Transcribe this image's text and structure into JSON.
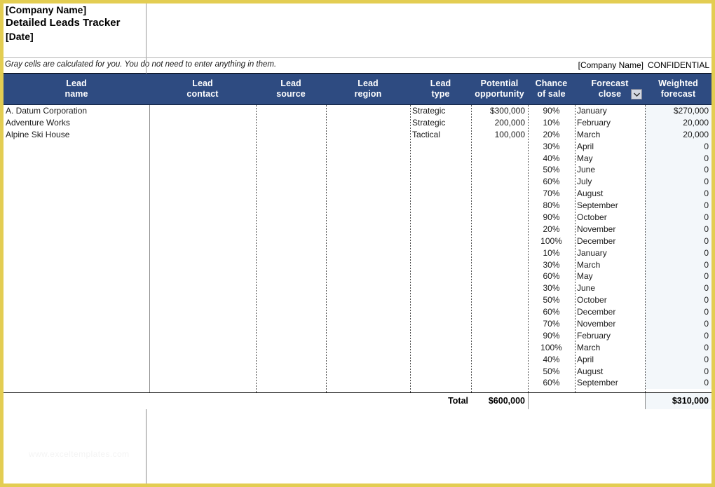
{
  "document": {
    "company_name": "[Company Name]",
    "title": "Detailed Leads Tracker",
    "date": "[Date]",
    "note": "Gray cells are calculated for you. You do not need to enter anything in them.",
    "confidential_company": "[Company Name]",
    "confidential_label": "CONFIDENTIAL",
    "watermark": "www.exceltemplates.com"
  },
  "colors": {
    "header_background": "#2e4b81",
    "header_text": "#ffffff",
    "page_border": "#e3cd52",
    "calculated_cell": "#f3f7fa",
    "grid_line": "#8c8c8c"
  },
  "table": {
    "columns": [
      {
        "line1": "Lead",
        "line2": "name",
        "key": "lead_name",
        "align": "left"
      },
      {
        "line1": "Lead",
        "line2": "contact",
        "key": "lead_contact",
        "align": "left"
      },
      {
        "line1": "Lead",
        "line2": "source",
        "key": "lead_source",
        "align": "left"
      },
      {
        "line1": "Lead",
        "line2": "region",
        "key": "lead_region",
        "align": "left"
      },
      {
        "line1": "Lead",
        "line2": "type",
        "key": "lead_type",
        "align": "left"
      },
      {
        "line1": "Potential",
        "line2": "opportunity",
        "key": "potential_opportunity",
        "align": "right"
      },
      {
        "line1": "Chance",
        "line2": "of sale",
        "key": "chance_of_sale",
        "align": "center"
      },
      {
        "line1": "Forecast",
        "line2": "close",
        "key": "forecast_close",
        "align": "left"
      },
      {
        "line1": "Weighted",
        "line2": "forecast",
        "key": "weighted_forecast",
        "align": "right"
      }
    ],
    "filter_column": "Forecast close",
    "filter_icon": "chevron-down-icon",
    "rows": [
      {
        "lead_name": "A. Datum Corporation",
        "lead_contact": "",
        "lead_source": "",
        "lead_region": "",
        "lead_type": "Strategic",
        "potential_opportunity": "$300,000",
        "chance_of_sale": "90%",
        "forecast_close": "January",
        "weighted_forecast": "$270,000"
      },
      {
        "lead_name": "Adventure Works",
        "lead_contact": "",
        "lead_source": "",
        "lead_region": "",
        "lead_type": "Strategic",
        "potential_opportunity": "200,000",
        "chance_of_sale": "10%",
        "forecast_close": "February",
        "weighted_forecast": "20,000"
      },
      {
        "lead_name": "Alpine Ski House",
        "lead_contact": "",
        "lead_source": "",
        "lead_region": "",
        "lead_type": "Tactical",
        "potential_opportunity": "100,000",
        "chance_of_sale": "20%",
        "forecast_close": "March",
        "weighted_forecast": "20,000"
      },
      {
        "lead_name": "",
        "lead_contact": "",
        "lead_source": "",
        "lead_region": "",
        "lead_type": "",
        "potential_opportunity": "",
        "chance_of_sale": "30%",
        "forecast_close": "April",
        "weighted_forecast": "0"
      },
      {
        "lead_name": "",
        "lead_contact": "",
        "lead_source": "",
        "lead_region": "",
        "lead_type": "",
        "potential_opportunity": "",
        "chance_of_sale": "40%",
        "forecast_close": "May",
        "weighted_forecast": "0"
      },
      {
        "lead_name": "",
        "lead_contact": "",
        "lead_source": "",
        "lead_region": "",
        "lead_type": "",
        "potential_opportunity": "",
        "chance_of_sale": "50%",
        "forecast_close": "June",
        "weighted_forecast": "0"
      },
      {
        "lead_name": "",
        "lead_contact": "",
        "lead_source": "",
        "lead_region": "",
        "lead_type": "",
        "potential_opportunity": "",
        "chance_of_sale": "60%",
        "forecast_close": "July",
        "weighted_forecast": "0"
      },
      {
        "lead_name": "",
        "lead_contact": "",
        "lead_source": "",
        "lead_region": "",
        "lead_type": "",
        "potential_opportunity": "",
        "chance_of_sale": "70%",
        "forecast_close": "August",
        "weighted_forecast": "0"
      },
      {
        "lead_name": "",
        "lead_contact": "",
        "lead_source": "",
        "lead_region": "",
        "lead_type": "",
        "potential_opportunity": "",
        "chance_of_sale": "80%",
        "forecast_close": "September",
        "weighted_forecast": "0"
      },
      {
        "lead_name": "",
        "lead_contact": "",
        "lead_source": "",
        "lead_region": "",
        "lead_type": "",
        "potential_opportunity": "",
        "chance_of_sale": "90%",
        "forecast_close": "October",
        "weighted_forecast": "0"
      },
      {
        "lead_name": "",
        "lead_contact": "",
        "lead_source": "",
        "lead_region": "",
        "lead_type": "",
        "potential_opportunity": "",
        "chance_of_sale": "20%",
        "forecast_close": "November",
        "weighted_forecast": "0"
      },
      {
        "lead_name": "",
        "lead_contact": "",
        "lead_source": "",
        "lead_region": "",
        "lead_type": "",
        "potential_opportunity": "",
        "chance_of_sale": "100%",
        "forecast_close": "December",
        "weighted_forecast": "0"
      },
      {
        "lead_name": "",
        "lead_contact": "",
        "lead_source": "",
        "lead_region": "",
        "lead_type": "",
        "potential_opportunity": "",
        "chance_of_sale": "10%",
        "forecast_close": "January",
        "weighted_forecast": "0"
      },
      {
        "lead_name": "",
        "lead_contact": "",
        "lead_source": "",
        "lead_region": "",
        "lead_type": "",
        "potential_opportunity": "",
        "chance_of_sale": "30%",
        "forecast_close": "March",
        "weighted_forecast": "0"
      },
      {
        "lead_name": "",
        "lead_contact": "",
        "lead_source": "",
        "lead_region": "",
        "lead_type": "",
        "potential_opportunity": "",
        "chance_of_sale": "60%",
        "forecast_close": "May",
        "weighted_forecast": "0"
      },
      {
        "lead_name": "",
        "lead_contact": "",
        "lead_source": "",
        "lead_region": "",
        "lead_type": "",
        "potential_opportunity": "",
        "chance_of_sale": "30%",
        "forecast_close": "June",
        "weighted_forecast": "0"
      },
      {
        "lead_name": "",
        "lead_contact": "",
        "lead_source": "",
        "lead_region": "",
        "lead_type": "",
        "potential_opportunity": "",
        "chance_of_sale": "50%",
        "forecast_close": "October",
        "weighted_forecast": "0"
      },
      {
        "lead_name": "",
        "lead_contact": "",
        "lead_source": "",
        "lead_region": "",
        "lead_type": "",
        "potential_opportunity": "",
        "chance_of_sale": "60%",
        "forecast_close": "December",
        "weighted_forecast": "0"
      },
      {
        "lead_name": "",
        "lead_contact": "",
        "lead_source": "",
        "lead_region": "",
        "lead_type": "",
        "potential_opportunity": "",
        "chance_of_sale": "70%",
        "forecast_close": "November",
        "weighted_forecast": "0"
      },
      {
        "lead_name": "",
        "lead_contact": "",
        "lead_source": "",
        "lead_region": "",
        "lead_type": "",
        "potential_opportunity": "",
        "chance_of_sale": "90%",
        "forecast_close": "February",
        "weighted_forecast": "0"
      },
      {
        "lead_name": "",
        "lead_contact": "",
        "lead_source": "",
        "lead_region": "",
        "lead_type": "",
        "potential_opportunity": "",
        "chance_of_sale": "100%",
        "forecast_close": "March",
        "weighted_forecast": "0"
      },
      {
        "lead_name": "",
        "lead_contact": "",
        "lead_source": "",
        "lead_region": "",
        "lead_type": "",
        "potential_opportunity": "",
        "chance_of_sale": "40%",
        "forecast_close": "April",
        "weighted_forecast": "0"
      },
      {
        "lead_name": "",
        "lead_contact": "",
        "lead_source": "",
        "lead_region": "",
        "lead_type": "",
        "potential_opportunity": "",
        "chance_of_sale": "50%",
        "forecast_close": "August",
        "weighted_forecast": "0"
      },
      {
        "lead_name": "",
        "lead_contact": "",
        "lead_source": "",
        "lead_region": "",
        "lead_type": "",
        "potential_opportunity": "",
        "chance_of_sale": "60%",
        "forecast_close": "September",
        "weighted_forecast": "0"
      }
    ],
    "total": {
      "label": "Total",
      "potential_opportunity": "$600,000",
      "weighted_forecast": "$310,000"
    }
  }
}
